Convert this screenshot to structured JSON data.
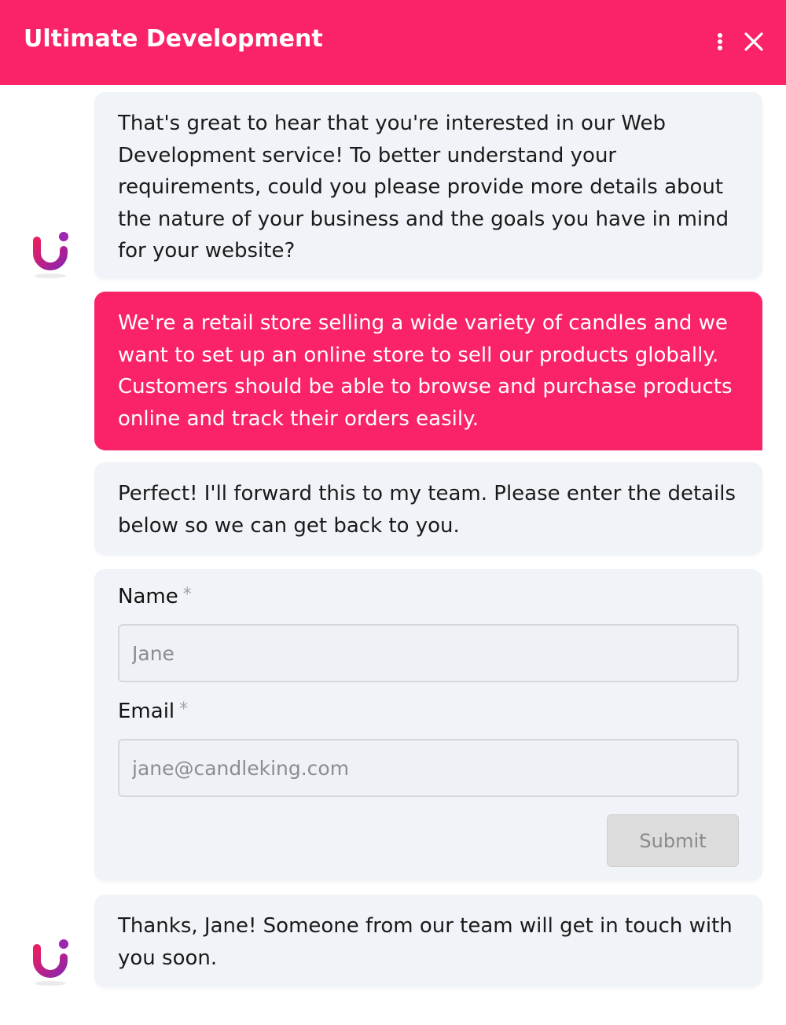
{
  "header": {
    "title": "Ultimate Development",
    "background": "#fa2367"
  },
  "messages": [
    {
      "sender": "bot",
      "text": "That's great to hear that you're interested in our Web Development service! To better understand your requirements, could you please provide more details about the nature of your business and the goals you have in mind for your website?"
    },
    {
      "sender": "user",
      "text": "We're a retail store selling a wide variety of candles and we want to set up an online store to sell our products globally. Customers should be able to browse and purchase products online and track their orders easily."
    },
    {
      "sender": "bot",
      "text": "Perfect! I'll forward this to my team. Please enter the details below so we can get back to you."
    },
    {
      "sender": "bot",
      "text": "Thanks, Jane! Someone from our team will get in touch with you soon."
    }
  ],
  "form": {
    "name_label": "Name",
    "name_required": "*",
    "name_placeholder": "Jane",
    "email_label": "Email",
    "email_required": "*",
    "email_placeholder": "jane@candleking.com",
    "submit_label": "Submit"
  },
  "icons": {
    "menu": "more-vertical-icon",
    "close": "close-icon",
    "avatar": "brand-logo-icon"
  },
  "colors": {
    "accent": "#fa2367",
    "bot_bubble": "#f0f3f7",
    "logo_gradient_start": "#d81b60",
    "logo_gradient_end": "#7b1fa2"
  }
}
